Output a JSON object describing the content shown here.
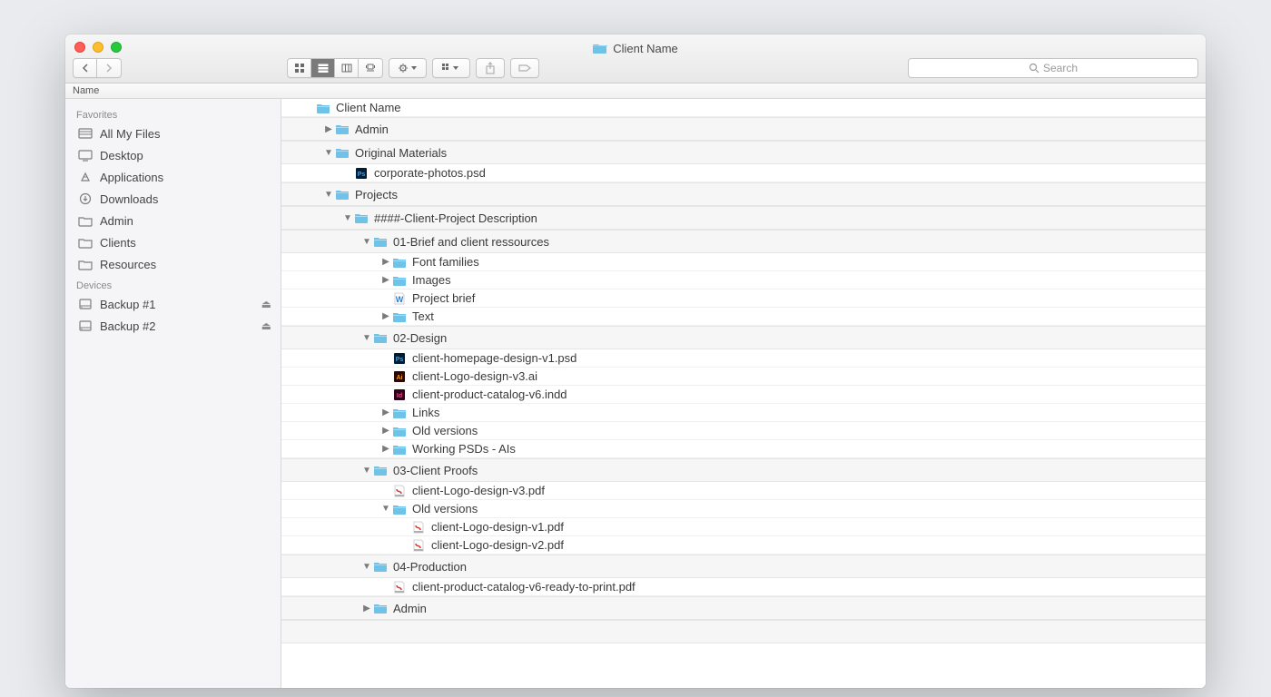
{
  "title": "Client Name",
  "search_placeholder": "Search",
  "header_name": "Name",
  "sidebar": {
    "sections": [
      {
        "label": "Favorites",
        "items": [
          {
            "icon": "allfiles",
            "label": "All My Files"
          },
          {
            "icon": "desktop",
            "label": "Desktop"
          },
          {
            "icon": "apps",
            "label": "Applications"
          },
          {
            "icon": "downloads",
            "label": "Downloads"
          },
          {
            "icon": "folder",
            "label": "Admin"
          },
          {
            "icon": "folder",
            "label": "Clients"
          },
          {
            "icon": "folder",
            "label": "Resources"
          }
        ]
      },
      {
        "label": "Devices",
        "items": [
          {
            "icon": "disk",
            "label": "Backup  #1",
            "eject": true
          },
          {
            "icon": "disk",
            "label": "Backup  #2",
            "eject": true
          }
        ]
      }
    ]
  },
  "rows": [
    {
      "indent": 0,
      "arrow": "",
      "type": "folder",
      "name": "Client Name"
    },
    {
      "indent": 1,
      "arrow": "right",
      "type": "folder",
      "name": "Admin",
      "group": true
    },
    {
      "indent": 1,
      "arrow": "down",
      "type": "folder",
      "name": "Original Materials",
      "group": true
    },
    {
      "indent": 2,
      "arrow": "",
      "type": "psd",
      "name": "corporate-photos.psd"
    },
    {
      "indent": 1,
      "arrow": "down",
      "type": "folder",
      "name": "Projects",
      "group": true
    },
    {
      "indent": 2,
      "arrow": "down",
      "type": "folder",
      "name": "####-Client-Project Description",
      "group": true
    },
    {
      "indent": 3,
      "arrow": "down",
      "type": "folder",
      "name": "01-Brief and client ressources",
      "group": true
    },
    {
      "indent": 4,
      "arrow": "right",
      "type": "folder",
      "name": "Font families"
    },
    {
      "indent": 4,
      "arrow": "right",
      "type": "folder",
      "name": "Images"
    },
    {
      "indent": 4,
      "arrow": "",
      "type": "word",
      "name": "Project brief"
    },
    {
      "indent": 4,
      "arrow": "right",
      "type": "folder",
      "name": "Text"
    },
    {
      "indent": 3,
      "arrow": "down",
      "type": "folder",
      "name": "02-Design",
      "group": true
    },
    {
      "indent": 4,
      "arrow": "",
      "type": "psd",
      "name": "client-homepage-design-v1.psd"
    },
    {
      "indent": 4,
      "arrow": "",
      "type": "ai",
      "name": "client-Logo-design-v3.ai"
    },
    {
      "indent": 4,
      "arrow": "",
      "type": "indd",
      "name": "client-product-catalog-v6.indd"
    },
    {
      "indent": 4,
      "arrow": "right",
      "type": "folder",
      "name": "Links"
    },
    {
      "indent": 4,
      "arrow": "right",
      "type": "folder",
      "name": "Old versions"
    },
    {
      "indent": 4,
      "arrow": "right",
      "type": "folder",
      "name": "Working PSDs - AIs"
    },
    {
      "indent": 3,
      "arrow": "down",
      "type": "folder",
      "name": "03-Client Proofs",
      "group": true
    },
    {
      "indent": 4,
      "arrow": "",
      "type": "pdf",
      "name": "client-Logo-design-v3.pdf"
    },
    {
      "indent": 4,
      "arrow": "down",
      "type": "folder",
      "name": "Old versions"
    },
    {
      "indent": 5,
      "arrow": "",
      "type": "pdf",
      "name": "client-Logo-design-v1.pdf"
    },
    {
      "indent": 5,
      "arrow": "",
      "type": "pdf",
      "name": "client-Logo-design-v2.pdf"
    },
    {
      "indent": 3,
      "arrow": "down",
      "type": "folder",
      "name": "04-Production",
      "group": true
    },
    {
      "indent": 4,
      "arrow": "",
      "type": "pdf",
      "name": "client-product-catalog-v6-ready-to-print.pdf"
    },
    {
      "indent": 3,
      "arrow": "right",
      "type": "folder",
      "name": "Admin",
      "group": true
    }
  ]
}
